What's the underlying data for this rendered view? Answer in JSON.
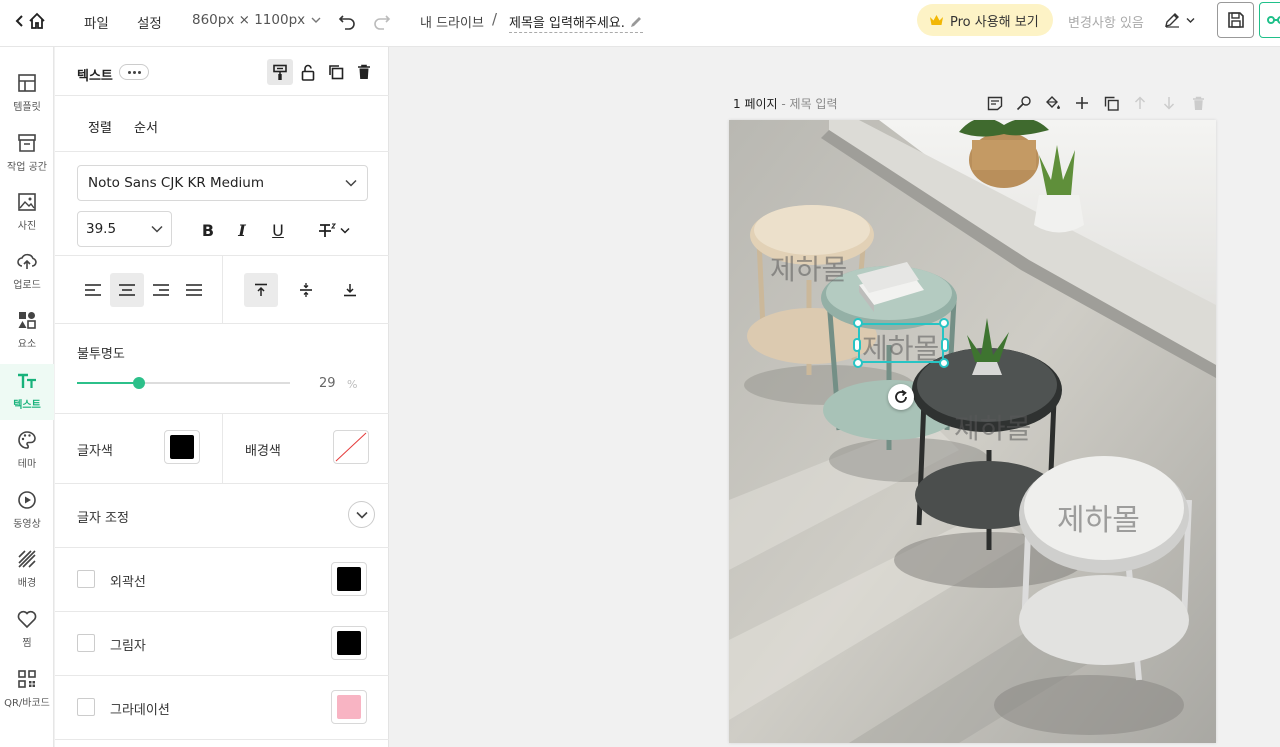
{
  "topbar": {
    "file_label": "파일",
    "settings_label": "설정",
    "canvas_size": "860px × 1100px",
    "drive_label": "내 드라이브",
    "separator": "/",
    "doc_title": "제목을 입력해주세요.",
    "pro_label": "Pro 사용해 보기",
    "changes_label": "변경사항 있음"
  },
  "rail": {
    "items": [
      {
        "label": "템플릿",
        "icon": "template-icon"
      },
      {
        "label": "작업 공간",
        "icon": "workspace-icon"
      },
      {
        "label": "사진",
        "icon": "photo-icon"
      },
      {
        "label": "업로드",
        "icon": "upload-icon"
      },
      {
        "label": "요소",
        "icon": "elements-icon"
      },
      {
        "label": "텍스트",
        "icon": "text-icon",
        "active": true
      },
      {
        "label": "테마",
        "icon": "palette-icon"
      },
      {
        "label": "동영상",
        "icon": "video-icon"
      },
      {
        "label": "배경",
        "icon": "background-icon"
      },
      {
        "label": "찜",
        "icon": "heart-icon"
      },
      {
        "label": "QR/바코드",
        "icon": "qr-icon"
      }
    ]
  },
  "panel": {
    "title": "텍스트",
    "tabs": {
      "align": "정렬",
      "order": "순서"
    },
    "font_family": "Noto Sans CJK KR Medium",
    "font_size": "39.5",
    "format": {
      "bold": "B",
      "italic": "I",
      "underline": "U"
    },
    "opacity": {
      "label": "불투명도",
      "value": "29",
      "unit": "%",
      "fraction": 0.29
    },
    "text_color": {
      "label": "글자색",
      "color": "#000000"
    },
    "bg_color": {
      "label": "배경색"
    },
    "text_adjust_label": "글자 조정",
    "outline": {
      "label": "외곽선",
      "color": "#000000"
    },
    "shadow": {
      "label": "그림자",
      "color": "#000000"
    },
    "gradient": {
      "label": "그라데이션",
      "color": "#f8b4c3"
    }
  },
  "canvas": {
    "page_number": "1 페이지",
    "page_title": " - 제목 입력",
    "watermark_text": "제하몰"
  }
}
